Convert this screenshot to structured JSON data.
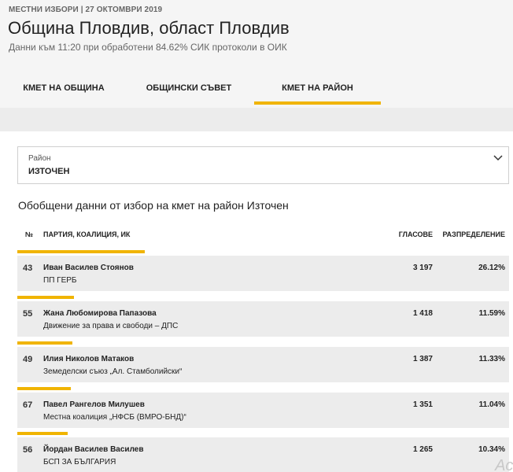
{
  "header": {
    "meta": "МЕСТНИ ИЗБОРИ | 27 ОКТОМВРИ 2019",
    "title": "Община Пловдив, област Пловдив",
    "subtitle": "Данни към 11:20 при обработени 84.62% СИК протоколи в ОИК"
  },
  "tabs": [
    {
      "label": "КМЕТ НА ОБЩИНА",
      "active": false
    },
    {
      "label": "ОБЩИНСКИ СЪВЕТ",
      "active": false
    },
    {
      "label": "КМЕТ НА РАЙОН",
      "active": true
    }
  ],
  "district_select": {
    "label": "Район",
    "value": "ИЗТОЧЕН",
    "icon": "chevron-down-icon"
  },
  "section_title": "Обобщени данни от избор на кмет на район Източен",
  "table": {
    "columns": {
      "num": "№",
      "party": "ПАРТИЯ, КОАЛИЦИЯ, ИК",
      "votes": "ГЛАСОВЕ",
      "dist": "РАЗПРЕДЕЛЕНИЕ"
    },
    "rows": [
      {
        "num": "43",
        "name": "Иван Василев Стоянов",
        "party": "ПП ГЕРБ",
        "votes": "3 197",
        "dist": "26.12%",
        "share": 26.12
      },
      {
        "num": "55",
        "name": "Жана Любомирова Папазова",
        "party": "Движение за права и свободи – ДПС",
        "votes": "1 418",
        "dist": "11.59%",
        "share": 11.59
      },
      {
        "num": "49",
        "name": "Илия Николов Матаков",
        "party": "Земеделски съюз „Ал. Стамболийски“",
        "votes": "1 387",
        "dist": "11.33%",
        "share": 11.33
      },
      {
        "num": "67",
        "name": "Павел Рангелов Милушев",
        "party": "Местна коалиция „НФСБ (ВМРО-БНД)“",
        "votes": "1 351",
        "dist": "11.04%",
        "share": 11.04
      },
      {
        "num": "56",
        "name": "Йордан Василев Василев",
        "party": "БСП ЗА БЪЛГАРИЯ",
        "votes": "1 265",
        "dist": "10.34%",
        "share": 10.34
      }
    ]
  },
  "watermark": "Act"
}
